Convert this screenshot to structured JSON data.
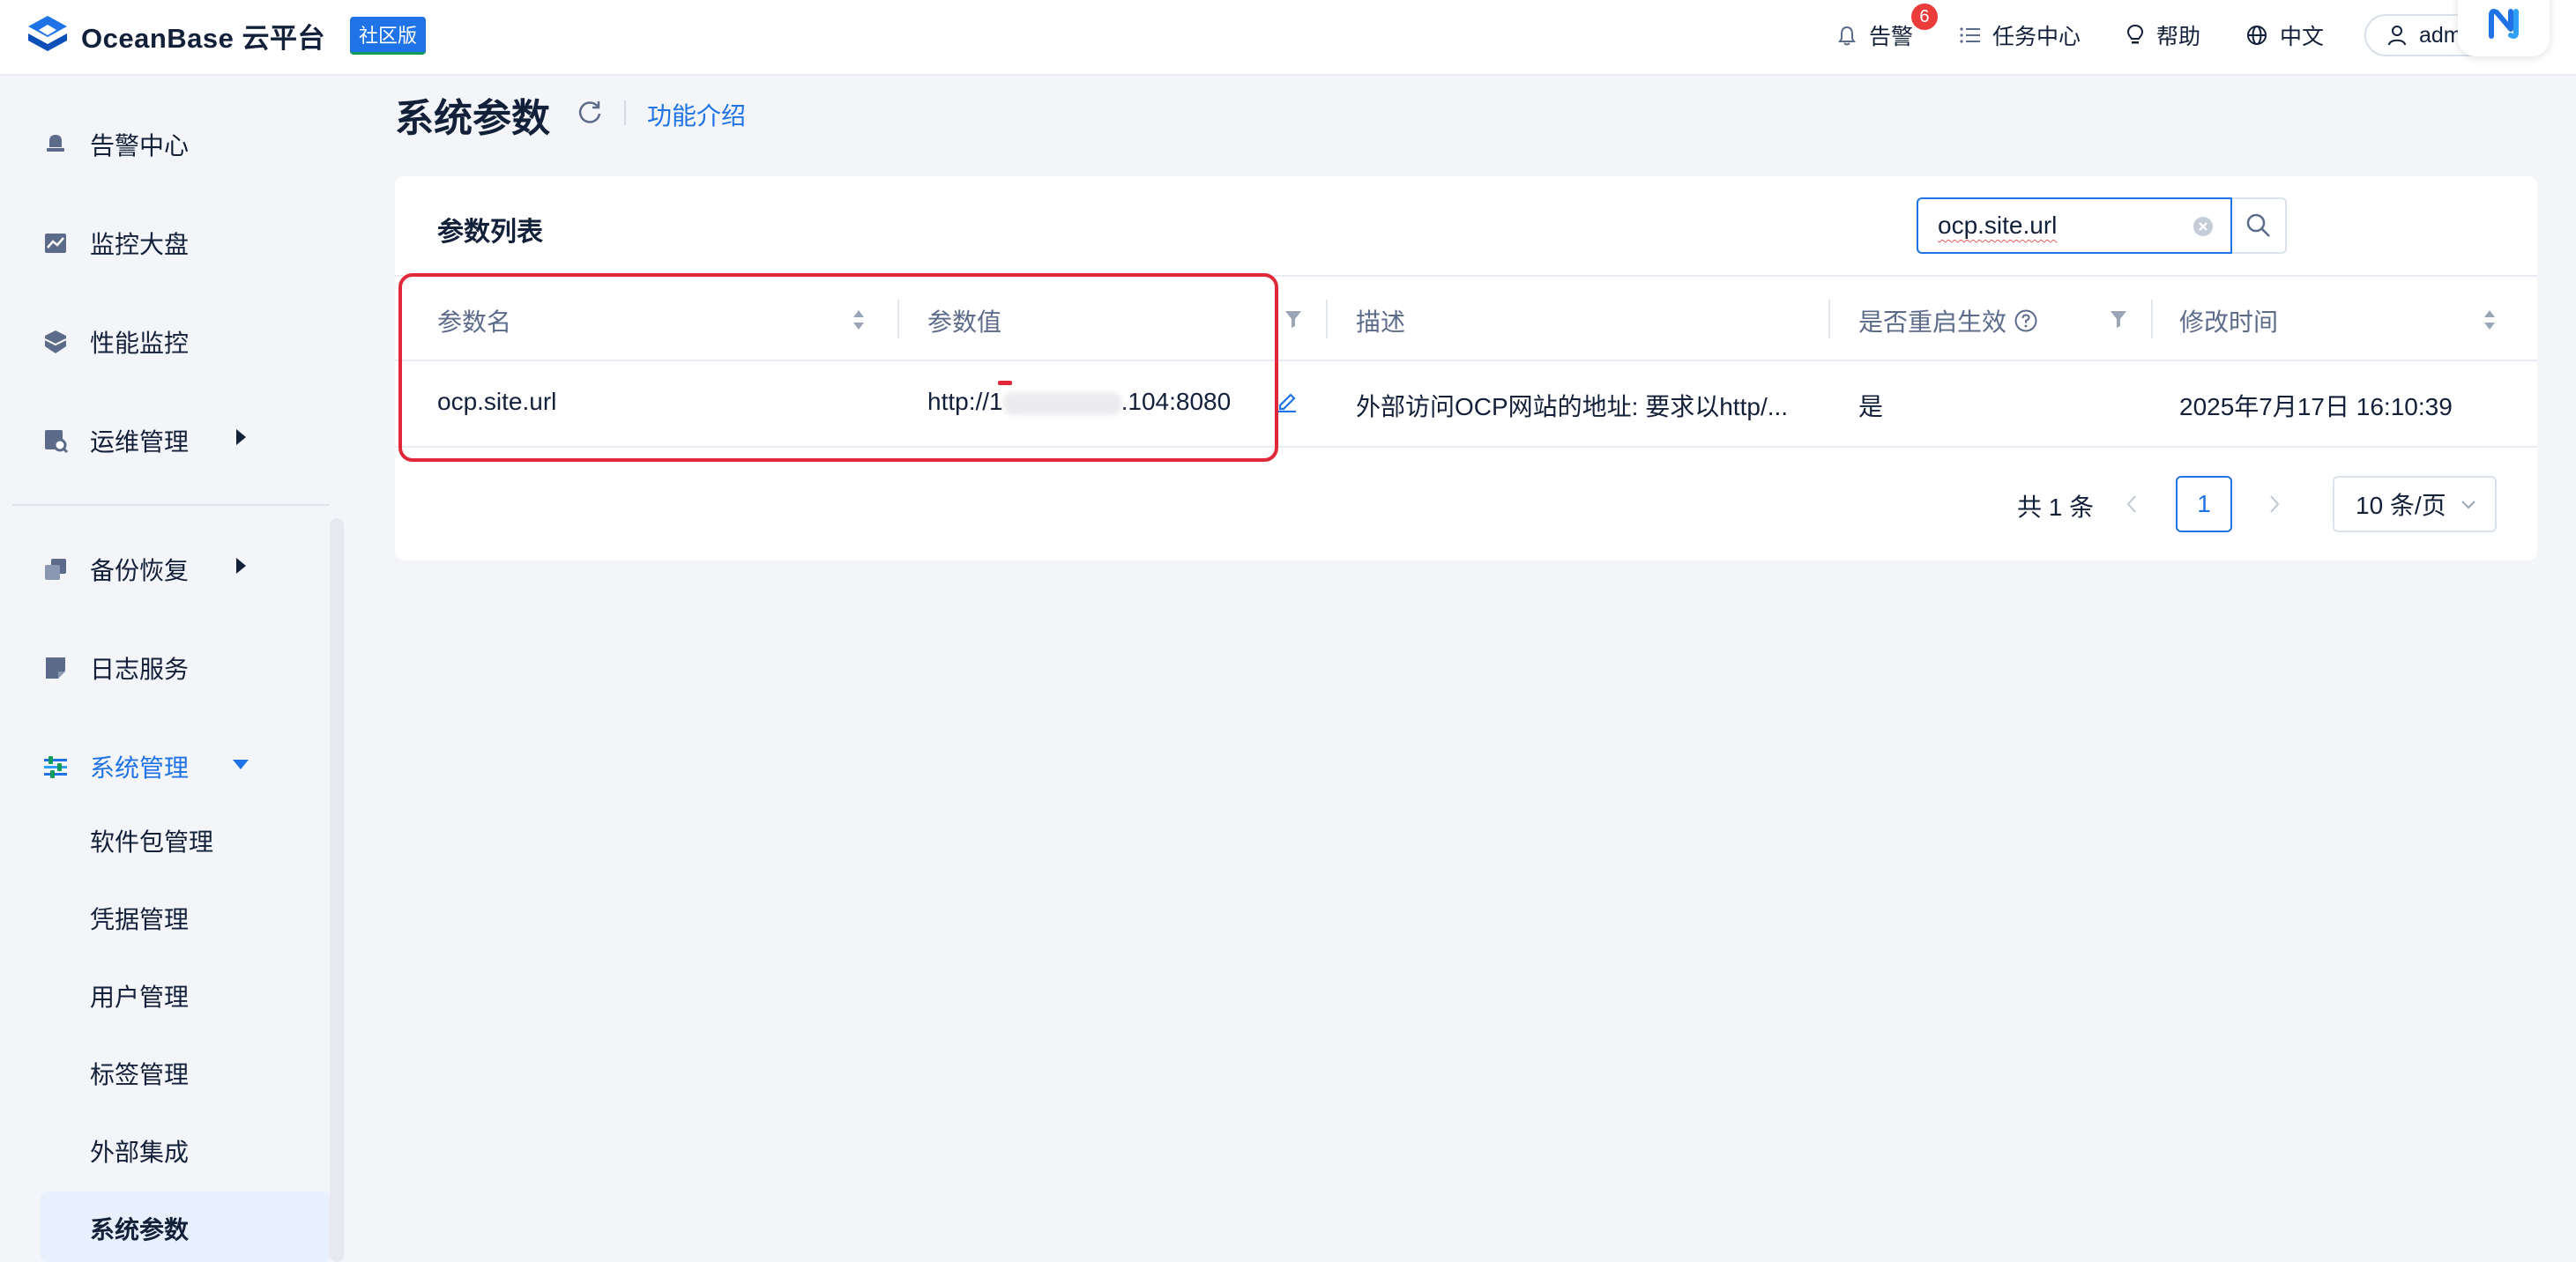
{
  "header": {
    "logo_text": "OceanBase 云平台",
    "edition_badge": "社区版",
    "alerts_label": "告警",
    "alerts_count": "6",
    "tasks_label": "任务中心",
    "help_label": "帮助",
    "language_label": "中文",
    "user_label": "admin",
    "icons": [
      "bell-icon",
      "list-icon",
      "bulb-icon",
      "globe-icon",
      "user-icon"
    ]
  },
  "sidebar": {
    "items": [
      {
        "label": "告警中心",
        "icon": "bell-icon"
      },
      {
        "label": "监控大盘",
        "icon": "chart-icon"
      },
      {
        "label": "性能监控",
        "icon": "shield-icon"
      },
      {
        "label": "运维管理",
        "icon": "ops-icon"
      },
      {
        "label": "备份恢复",
        "icon": "backup-icon"
      },
      {
        "label": "日志服务",
        "icon": "log-icon"
      },
      {
        "label": "系统管理",
        "icon": "settings-icon"
      }
    ],
    "sub_items": [
      "软件包管理",
      "凭据管理",
      "用户管理",
      "标签管理",
      "外部集成",
      "系统参数"
    ],
    "active_item": "系统管理",
    "selected_sub_item": "系统参数",
    "accent_color": "#1f73e6"
  },
  "page": {
    "title": "系统参数",
    "intro_link": "功能介绍"
  },
  "card": {
    "title": "参数列表",
    "search": {
      "value": "ocp.site.url"
    }
  },
  "table": {
    "columns": [
      "参数名",
      "参数值",
      "描述",
      "是否重启生效",
      "修改时间"
    ],
    "rows": [
      {
        "name": "ocp.site.url",
        "value_prefix": "http://1",
        "value_suffix": ".104:8080",
        "description": "外部访问OCP网站的地址: 要求以http/...",
        "restart": "是",
        "modified": "2025年7月17日 16:10:39"
      }
    ]
  },
  "pagination": {
    "total": "共 1 条",
    "current_page": "1",
    "page_size": "10 条/页"
  }
}
